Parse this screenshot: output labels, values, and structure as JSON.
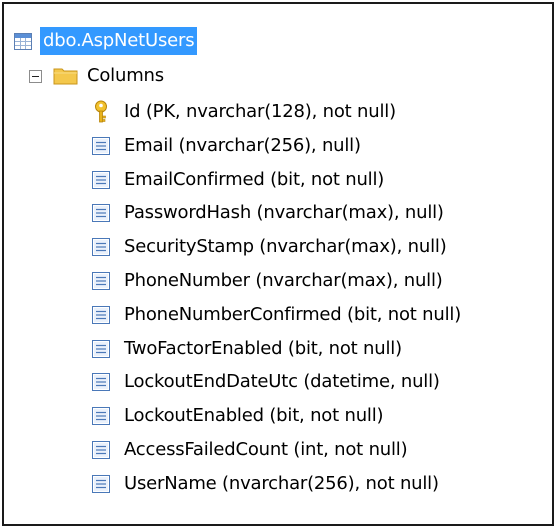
{
  "tree": {
    "root": {
      "label": "dbo.AspNetUsers",
      "icon": "table-icon",
      "selected": true
    },
    "folder": {
      "label": "Columns",
      "icon": "folder-icon",
      "expanded": true
    },
    "columns": [
      {
        "label": "Id (PK, nvarchar(128), not null)",
        "icon": "key-icon"
      },
      {
        "label": "Email (nvarchar(256), null)",
        "icon": "column-icon"
      },
      {
        "label": "EmailConfirmed (bit, not null)",
        "icon": "column-icon"
      },
      {
        "label": "PasswordHash (nvarchar(max), null)",
        "icon": "column-icon"
      },
      {
        "label": "SecurityStamp (nvarchar(max), null)",
        "icon": "column-icon"
      },
      {
        "label": "PhoneNumber (nvarchar(max), null)",
        "icon": "column-icon"
      },
      {
        "label": "PhoneNumberConfirmed (bit, not null)",
        "icon": "column-icon"
      },
      {
        "label": "TwoFactorEnabled (bit, not null)",
        "icon": "column-icon"
      },
      {
        "label": "LockoutEndDateUtc (datetime, null)",
        "icon": "column-icon"
      },
      {
        "label": "LockoutEnabled (bit, not null)",
        "icon": "column-icon"
      },
      {
        "label": "AccessFailedCount (int, not null)",
        "icon": "column-icon"
      },
      {
        "label": "UserName (nvarchar(256), not null)",
        "icon": "column-icon"
      }
    ]
  },
  "colors": {
    "selection": "#3399ff",
    "folder": "#f4c84c",
    "key": "#e8b21c",
    "column_icon_border": "#4a78b8"
  }
}
